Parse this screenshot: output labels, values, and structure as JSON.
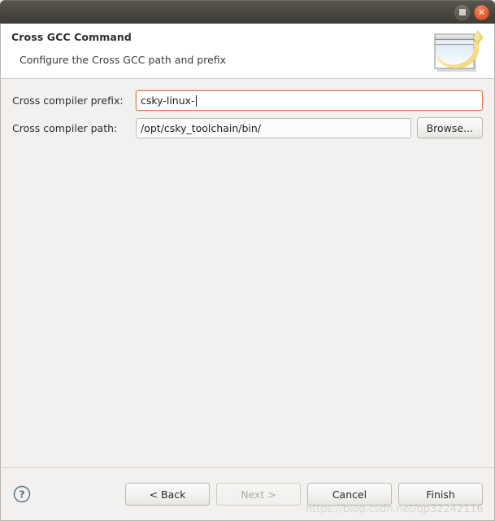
{
  "window": {
    "titlebar": {
      "maximize_label": "Restore",
      "close_label": "✕"
    }
  },
  "banner": {
    "title": "Cross GCC Command",
    "subtitle": "Configure the Cross GCC path and prefix",
    "icon": "wizard-window-icon"
  },
  "form": {
    "rows": [
      {
        "label": "Cross compiler prefix:",
        "value": "csky-linux-",
        "placeholder": "",
        "focused": true,
        "has_browse": false
      },
      {
        "label": "Cross compiler path:",
        "value": "/opt/csky_toolchain/bin/",
        "placeholder": "",
        "focused": false,
        "has_browse": true,
        "browse_label": "Browse..."
      }
    ]
  },
  "footer": {
    "help_icon": "help-question-icon",
    "buttons": {
      "back": "< Back",
      "next": "Next >",
      "cancel": "Cancel",
      "finish": "Finish"
    },
    "next_enabled": false
  },
  "watermark": {
    "text": "https://blog.csdn.net/qp32242116"
  },
  "colors": {
    "titlebar_dark": "#3e3c37",
    "close_button": "#e4683a",
    "focus_border": "#e8764a",
    "body_background": "#f2f1ef",
    "banner_background": "#ffffff",
    "help_icon": "#5a6d8c"
  }
}
